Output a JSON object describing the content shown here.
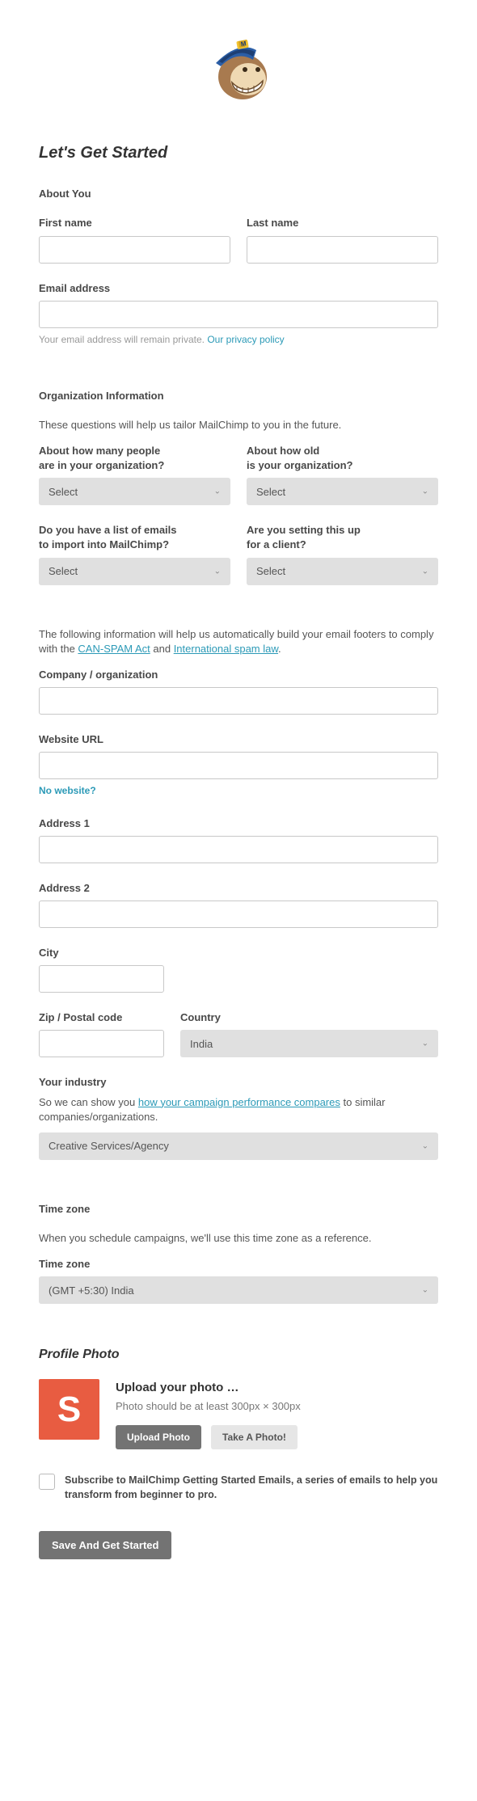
{
  "heading": "Let's Get Started",
  "section_about": "About You",
  "fields": {
    "first_name": "First name",
    "last_name": "Last name",
    "email": "Email address",
    "email_hint": "Your email address will remain private. ",
    "privacy_link": "Our privacy policy"
  },
  "org": {
    "title": "Organization Information",
    "intro": "These questions will help us tailor MailChimp to you in the future.",
    "q_people_l1": "About how many people",
    "q_people_l2": "are in your organization?",
    "q_age_l1": "About how old",
    "q_age_l2": "is your organization?",
    "q_list_l1": "Do you have a list of emails",
    "q_list_l2": "to import into MailChimp?",
    "q_client_l1": "Are you setting this up",
    "q_client_l2": "for a client?",
    "select_placeholder": "Select"
  },
  "footer_info": {
    "pretext": "The following information will help us automatically build your email footers to comply with the ",
    "link1": "CAN-SPAM Act",
    "mid": " and ",
    "link2": "International spam law",
    "end": "."
  },
  "company": {
    "company_label": "Company / organization",
    "website_label": "Website URL",
    "no_website": "No website?",
    "address1": "Address 1",
    "address2": "Address 2",
    "city": "City",
    "zip": "Zip / Postal code",
    "country": "Country",
    "country_value": "India"
  },
  "industry": {
    "label": "Your industry",
    "pre": "So we can show you ",
    "link": "how your campaign performance compares",
    "post": " to similar companies/organizations.",
    "value": "Creative Services/Agency"
  },
  "timezone": {
    "heading": "Time zone",
    "intro": "When you schedule campaigns, we'll use this time zone as a reference.",
    "label": "Time zone",
    "value": "(GMT +5:30) India"
  },
  "profile": {
    "heading": "Profile Photo",
    "avatar_letter": "S",
    "upload_title": "Upload your photo …",
    "upload_sub": "Photo should be at least 300px × 300px",
    "btn_upload": "Upload Photo",
    "btn_take": "Take A Photo!"
  },
  "subscribe_text": "Subscribe to MailChimp Getting Started Emails, a series of emails to help you transform from beginner to pro.",
  "submit": "Save And Get Started"
}
